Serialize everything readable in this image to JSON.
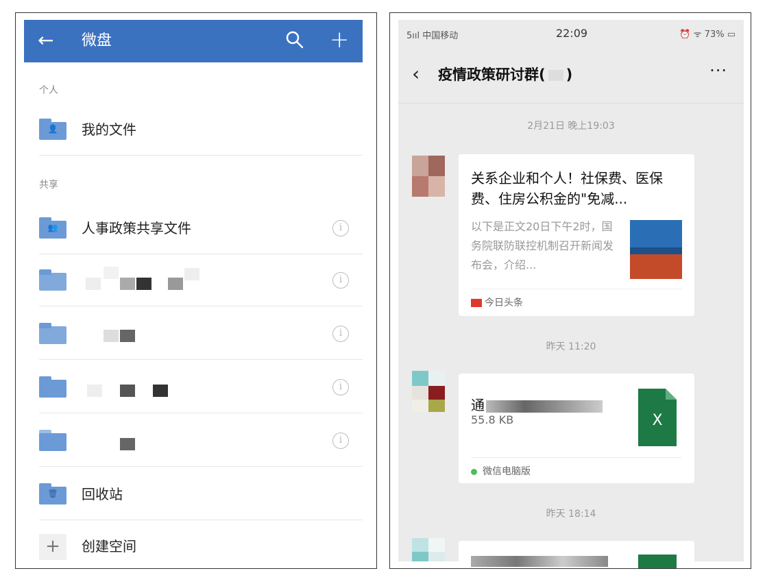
{
  "left": {
    "header": {
      "back_icon": "arrow-left-icon",
      "title": "微盘",
      "search_icon": "search-icon",
      "add_icon": "plus-icon"
    },
    "sections": {
      "personal": "个人",
      "shared": "共享"
    },
    "rows": {
      "my_files": "我的文件",
      "hr_policy": "人事政策共享文件",
      "recycle": "回收站",
      "create_space": "创建空间"
    },
    "colors": {
      "header": "#3b72c0",
      "folder": "#6b9ad6"
    }
  },
  "right": {
    "status": {
      "carrier": "5ııl 中国移动",
      "time": "22:09",
      "right": "⏰ ᯤ 73% ▭"
    },
    "nav": {
      "title": "疫情政策研讨群(",
      "title_end": ")",
      "more": "···"
    },
    "timestamps": [
      "2月21日 晚上19:03",
      "昨天 11:20",
      "昨天 18:14"
    ],
    "article": {
      "title": "关系企业和个人！社保费、医保费、住房公积金的\"免减...",
      "snippet": "以下是正文20日下午2时，国务院联防联控机制召开新闻发布会，介绍...",
      "source": "今日头条"
    },
    "file": {
      "name": "通",
      "size": "55.8 KB",
      "icon_letter": "X",
      "source": "微信电脑版"
    },
    "colors": {
      "excel": "#1d7a45",
      "source_red": "#e0392b",
      "wechat_green": "#4bbf5a"
    }
  }
}
